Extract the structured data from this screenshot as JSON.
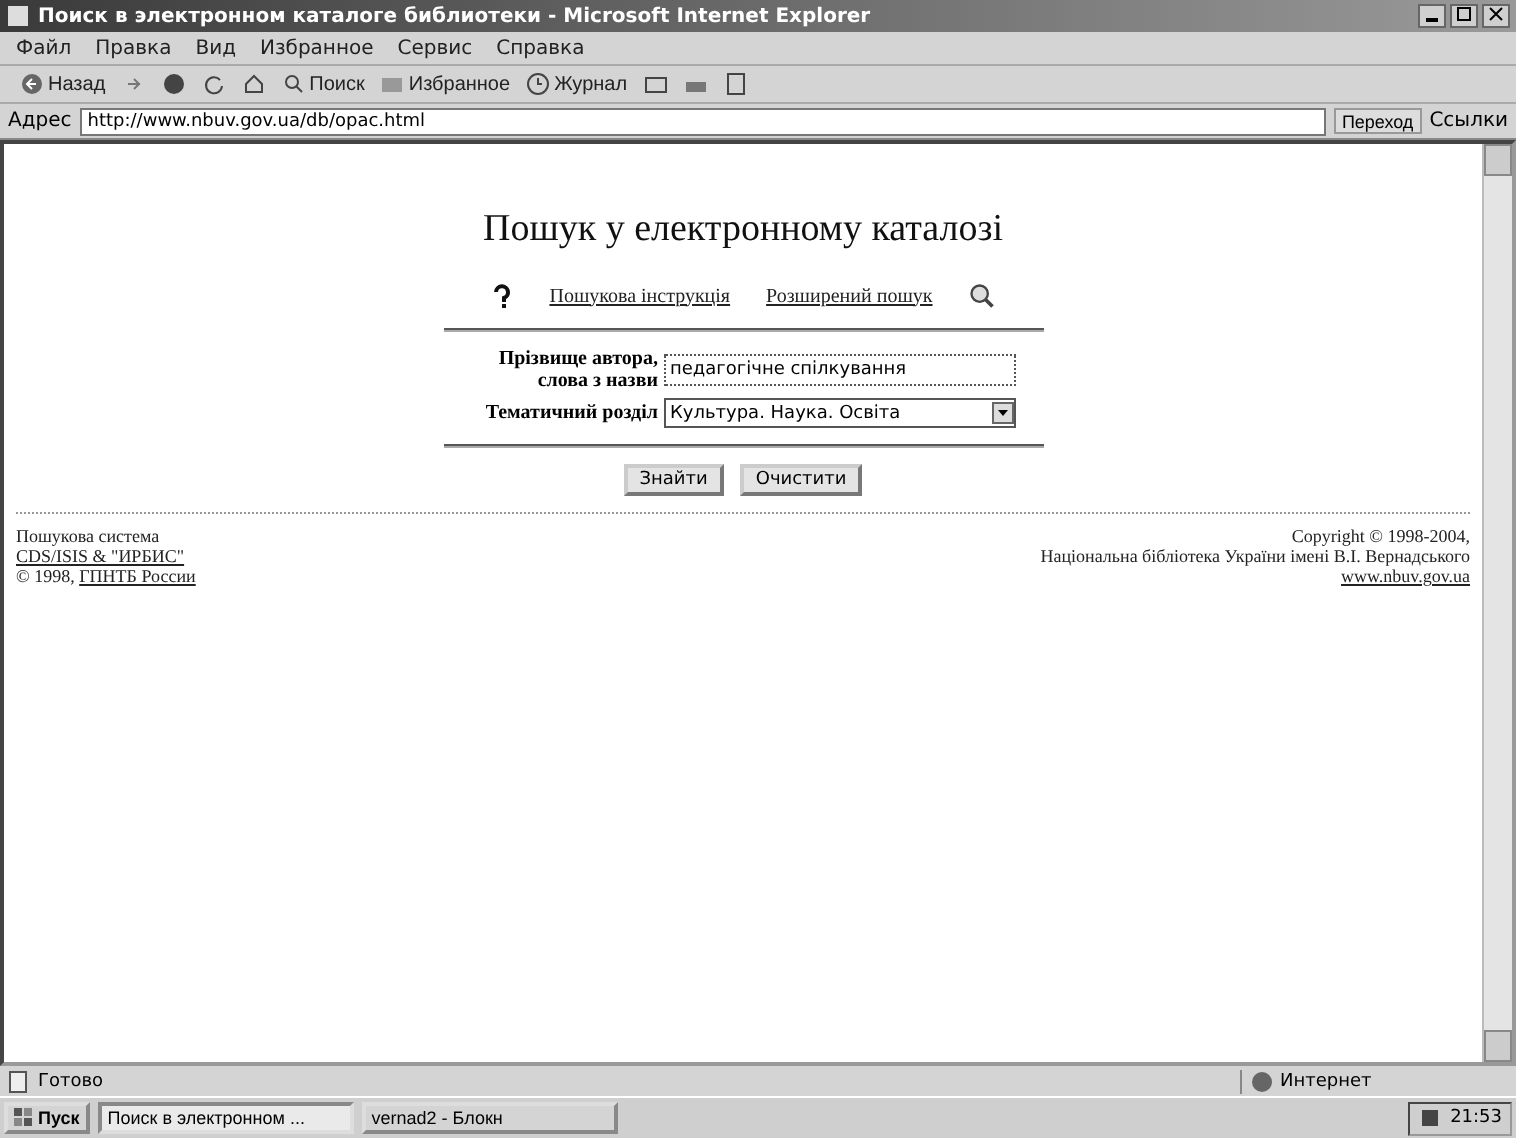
{
  "window": {
    "title": "Поиск в электронном каталоге библиотеки - Microsoft Internet Explorer"
  },
  "menu": [
    "Файл",
    "Правка",
    "Вид",
    "Избранное",
    "Сервис",
    "Справка"
  ],
  "toolbar": [
    {
      "kind": "back",
      "label": "Назад"
    },
    {
      "kind": "forward"
    },
    {
      "kind": "stop"
    },
    {
      "kind": "refresh"
    },
    {
      "kind": "home"
    },
    {
      "kind": "search",
      "label": "Поиск"
    },
    {
      "kind": "favorites",
      "label": "Избранное"
    },
    {
      "kind": "history",
      "label": "Журнал"
    },
    {
      "kind": "mail"
    },
    {
      "kind": "print"
    },
    {
      "kind": "edit"
    }
  ],
  "address": {
    "label": "Адрес",
    "value": "http://www.nbuv.gov.ua/db/opac.html",
    "go": "Переход",
    "links": "Ссылки"
  },
  "page": {
    "heading": "Пошук у електронному каталозі",
    "links": [
      {
        "kind": "help",
        "label": "Пошукова інструкція"
      },
      {
        "kind": "search",
        "label": "Розширений пошук"
      }
    ],
    "fields": [
      {
        "kind": "text",
        "label": "Прізвище автора, слова з назви",
        "value": "педагогічне спілкування"
      },
      {
        "kind": "select",
        "label": "Тематичний розділ",
        "value": "Культура. Наука. Освіта"
      }
    ],
    "buttons": [
      "Знайти",
      "Очистити"
    ],
    "footer_left": [
      {
        "text": "Пошукова система",
        "link": false
      },
      {
        "text": "CDS/ISIS & \"ИРБИС\"",
        "link": true
      },
      {
        "text": "© 1998, ",
        "link": false,
        "suffix": "ГПНТБ России"
      }
    ],
    "footer_right": [
      {
        "text": "Copyright © 1998-2004,",
        "link": false
      },
      {
        "text": "Національна бібліотека України імені В.І. Вернадського",
        "link": false
      },
      {
        "text": "www.nbuv.gov.ua",
        "link": true
      }
    ]
  },
  "status_bar": {
    "text": "Готово",
    "zone": "Интернет"
  },
  "taskbar": {
    "start": "Пуск",
    "tasks": [
      {
        "label": "Поиск в электронном ...",
        "selected": true
      },
      {
        "label": "vernad2 - Блокн",
        "selected": false
      }
    ],
    "time": "21:53"
  }
}
